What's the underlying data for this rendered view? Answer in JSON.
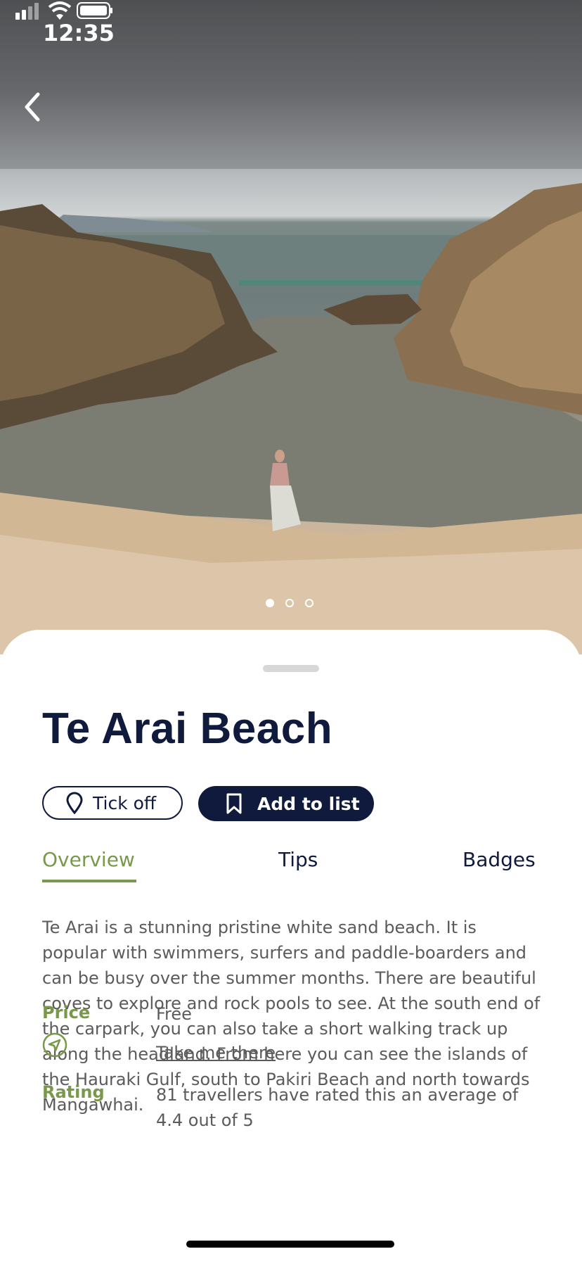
{
  "status_bar": {
    "time": "12:35"
  },
  "hero": {
    "image_count": 3,
    "active_index": 0
  },
  "place": {
    "title": "Te Arai Beach"
  },
  "actions": {
    "tick_off_label": "Tick off",
    "add_to_list_label": "Add to list"
  },
  "tabs": [
    {
      "label": "Overview",
      "active": true
    },
    {
      "label": "Tips",
      "active": false
    },
    {
      "label": "Badges",
      "active": false
    }
  ],
  "overview": {
    "description": "Te Arai is a stunning pristine white sand beach. It is popular with swimmers, surfers and paddle-boarders and can be busy over the summer months. There are beautiful coves to explore and rock pools to see. At the south end of the carpark, you can also take a short walking track up along the headland. From here you can see the islands of the Hauraki Gulf, south to Pakiri Beach and north towards Mangawhai.",
    "price_label": "Price",
    "price_value": "Free",
    "directions_link": "Take me there",
    "rating_label": "Rating",
    "rating_value": "81 travellers have rated this an average of 4.4 out of 5"
  },
  "colors": {
    "navy": "#0f1a3c",
    "accent_green": "#79994a",
    "body_text": "#5b5b5b"
  }
}
